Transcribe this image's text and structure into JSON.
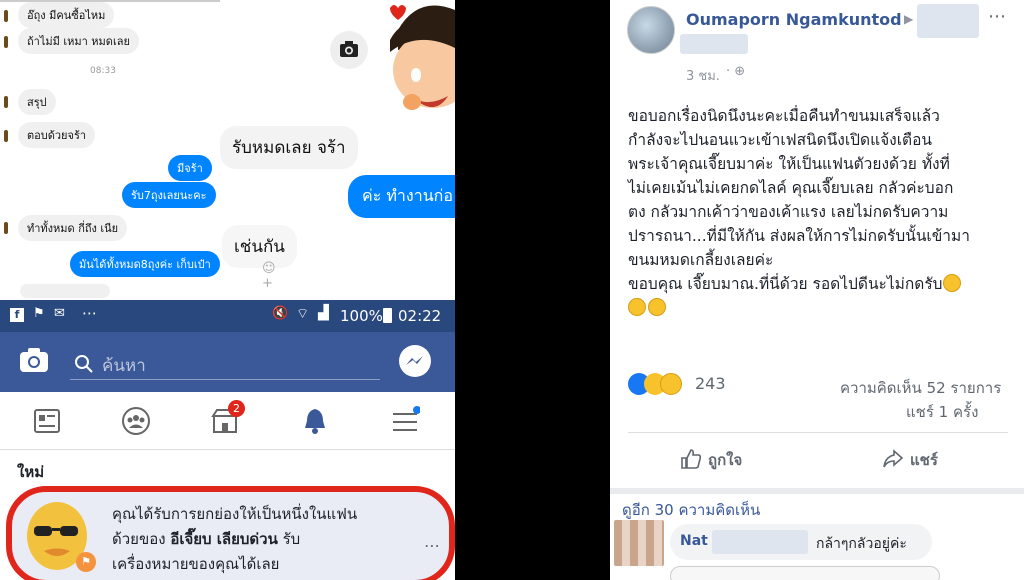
{
  "chat": {
    "msgs_left": [
      "อ๊ถุง มีคนซื้อไหม",
      "ถ้าไม่มี เหมา หมดเลย",
      "สรุป",
      "ตอบด้วยจร้า",
      "ทำทั้งหมด กี่ถึง เนีย"
    ],
    "time": "08:33",
    "msgs_right": [
      "มีจร้า",
      "รับ7ถุงเลยนะคะ",
      "มันได้ทั้งหมด8ถุงค่ะ เก็บเป๋า"
    ],
    "big_left_1": "รับหมดเลย จร้า",
    "big_left_2": "เช่นกัน",
    "big_right": "ค่ะ ทำงานก่อ"
  },
  "statusbar": {
    "battery": "100%",
    "time": "02:22"
  },
  "fbapp": {
    "search_placeholder": "ค้นหา",
    "badge": "2",
    "section": "ใหม่",
    "notif_pre": "คุณได้รับการยกย่องให้เป็นหนึ่งในแฟน",
    "notif_mid_pre": "ด้วยของ",
    "notif_bold": "อีเจี๊ยบ เลียบด่วน",
    "notif_mid_post": "รับ",
    "notif_post": "เครื่องหมายของคุณได้เลย"
  },
  "post": {
    "author": "Oumaporn Ngamkuntod",
    "time": "3 ชม.",
    "lines": [
      "ขอบอกเรื่องนิดนึงนะคะเมื่อคืนทำขนมเสร็จแล้ว",
      "กำลังจะไปนอนแวะเข้าเฟสนิดนึงเปิดแจ้งเตือน",
      "พระเจ้าคุณเจี๊ยบมาค่ะ ให้เป็นแฟนตัวยงด้วย ทั้งที่",
      "ไม่เคยเม้นไม่เคยกดไลค์ คุณเจี๊ยบเลย กลัวค่ะบอก",
      "ตง กลัวมากเค้าว่าของเค้าแรง เลยไม่กดรับความ",
      "ปรารถนา...ที่มีให้กัน ส่งผลให้การไม่กดรับนั้นเข้ามา",
      "ขนมหมดเกลี้ยงเลยค่ะ",
      "ขอบคุณ เจี๊ยบมาณ.ที่นี่ด้วย รอดไปดีนะไม่กดรับ"
    ],
    "reaction_count": "243",
    "comments": "ความคิดเห็น 52 รายการ",
    "shares": "แชร์ 1 ครั้ง",
    "like_label": "ถูกใจ",
    "share_label": "แชร์",
    "more_comments": "ดูอีก 30 ความคิดเห็น",
    "commenter": "Nat",
    "comment_text": "กล้าๆกลัวอยู่ค่ะ",
    "colors": {
      "fb_blue": "#3b5998",
      "messenger_blue": "#0084ff",
      "link": "#385898",
      "circle_red": "#e0261b"
    }
  }
}
